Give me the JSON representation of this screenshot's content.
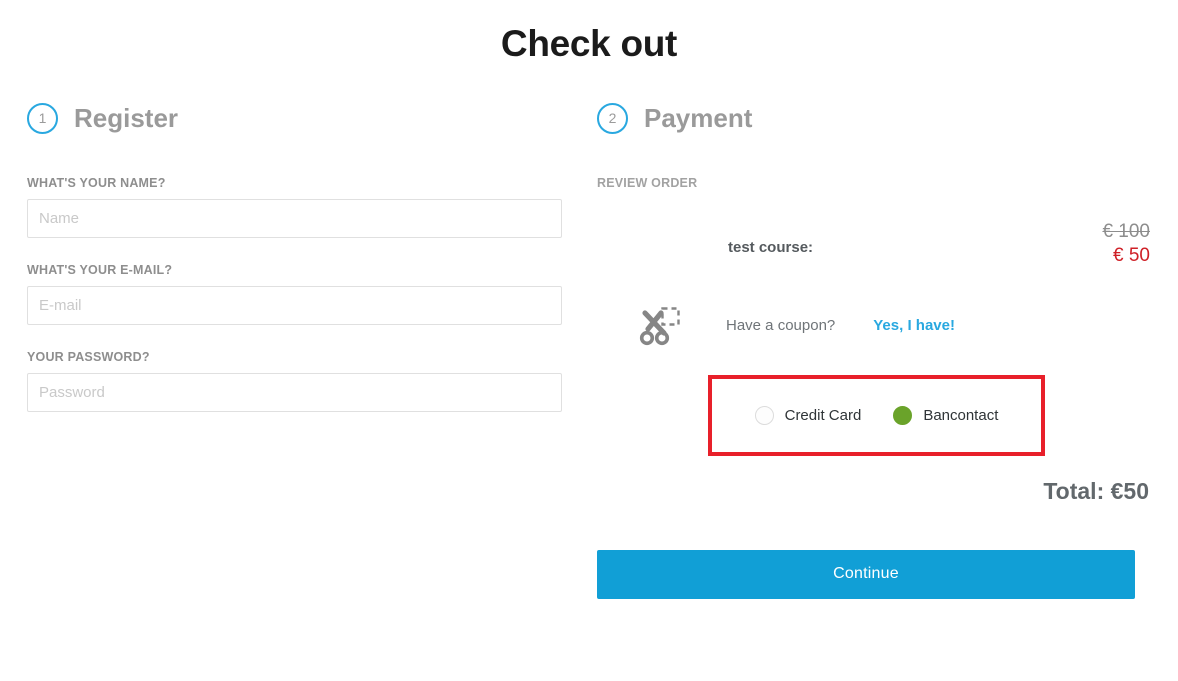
{
  "page": {
    "title": "Check out"
  },
  "register": {
    "step_number": "1",
    "heading": "Register",
    "fields": [
      {
        "label": "WHAT'S YOUR NAME?",
        "placeholder": "Name",
        "value": "",
        "type": "text"
      },
      {
        "label": "WHAT'S YOUR E-MAIL?",
        "placeholder": "E-mail",
        "value": "",
        "type": "text"
      },
      {
        "label": "YOUR PASSWORD?",
        "placeholder": "Password",
        "value": "",
        "type": "password"
      }
    ]
  },
  "payment": {
    "step_number": "2",
    "heading": "Payment",
    "review_label": "REVIEW ORDER",
    "order": {
      "item_name": "test course:",
      "price_original": "€ 100",
      "price_discounted": "€ 50"
    },
    "coupon": {
      "icon": "scissors-icon",
      "question": "Have a coupon?",
      "link_label": "Yes, I have!"
    },
    "methods": [
      {
        "label": "Credit Card",
        "selected": false
      },
      {
        "label": "Bancontact",
        "selected": true
      }
    ],
    "total_label": "Total: €50",
    "continue_label": "Continue"
  },
  "colors": {
    "accent_blue": "#29a8e0",
    "button_blue": "#119fd6",
    "highlight_red": "#e8202a",
    "price_red": "#cf2027",
    "selected_green": "#6aa32a",
    "label_gray": "#8e8e8e"
  }
}
